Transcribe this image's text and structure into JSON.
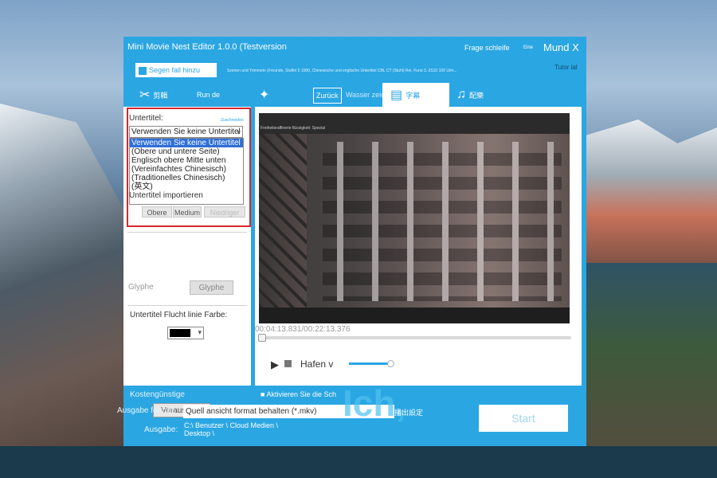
{
  "app": {
    "title": "Mini Movie Nest Editor 1.0.0 (Testversion",
    "help": "Frage schleife",
    "tiny_button": "Eine",
    "close": "Mund X",
    "url_label": "Segen fall hinzu",
    "sub_info": "Szenen und Trimmeln (Freunde, Staffel 5 1080, Chinesische und englische Untertitel CBL CT (Stuhl) Rei. Fund 3. 2S10 100 U/m...",
    "tutorial": "Tutor ial"
  },
  "toolbar": {
    "items": [
      {
        "label": "剪輯",
        "icon": "scissors-icon"
      },
      {
        "label": "Run de",
        "icon": "crop-icon"
      },
      {
        "label": "",
        "icon": "sparkle-icon"
      },
      {
        "label": "Zurück",
        "icon": "back-icon"
      },
      {
        "label": "Wasser zeichen",
        "icon": "watermark-icon"
      },
      {
        "label": "字幕",
        "icon": "subtitle-icon"
      },
      {
        "label": "配樂",
        "icon": "music-icon"
      }
    ],
    "active_index": 5
  },
  "subtitle_panel": {
    "label": "Untertitel:",
    "zoom_link": "Zuschneiden",
    "selected": "Verwenden Sie keine Untertitel",
    "options": [
      "Verwenden Sie keine Untertitel",
      "(Obere und untere Seite)",
      "Englisch obere Mitte unten",
      "(Vereinfachtes Chinesisch)",
      "(Traditionelles Chinesisch)",
      "(英文)"
    ],
    "import_label": "Untertitel importieren",
    "positions": [
      "Obere",
      "Medium",
      "Niedriger"
    ],
    "glyph_label": "Glyphe",
    "glyph_button": "Glyphe",
    "outline_label": "Untertitel Flucht linie Farbe:",
    "outline_color": "#000000",
    "preset_button": "Vorauswahl"
  },
  "preview": {
    "caption": "Freiheitsraffinerie flüssigkeit: Spezial",
    "time": "00:04:13.831/00:22:13.376",
    "seek_fraction": 0.0,
    "volume_label": "Hafen v",
    "volume_fraction": 1.0
  },
  "bottom": {
    "vendor_label": "Kostengünstige",
    "format_label": "Ausgabe format:",
    "format_value": "Quell ansicht format behalten (*.mkv)",
    "output_label": "Ausgabe:",
    "output_path": "C:\\ Benutzer \\ Cloud Medien \\ Desktop \\",
    "enable_link": "Aktivieren Sie die Sch",
    "big_text": "Ich,",
    "cn_label": "播出設定",
    "start": "Start"
  },
  "colors": {
    "accent": "#2aa6e3",
    "highlight": "#2f6fd6",
    "red_box": "#d9262c"
  }
}
